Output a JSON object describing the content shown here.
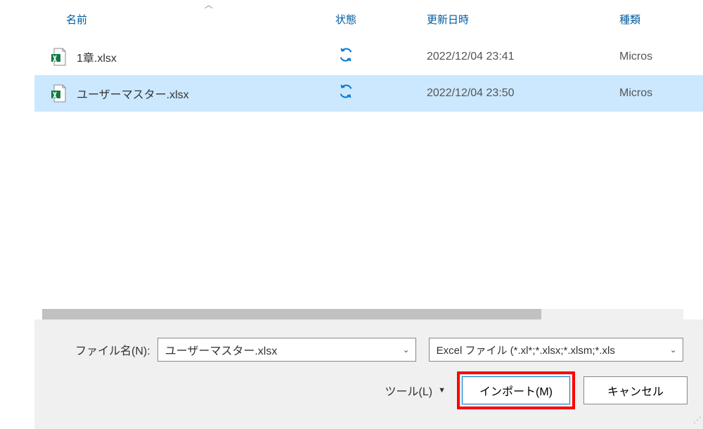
{
  "columns": {
    "name": "名前",
    "status": "状態",
    "date": "更新日時",
    "type": "種類"
  },
  "files": [
    {
      "name": "1章.xlsx",
      "date": "2022/12/04 23:41",
      "type": "Micros",
      "selected": false
    },
    {
      "name": "ユーザーマスター.xlsx",
      "date": "2022/12/04 23:50",
      "type": "Micros",
      "selected": true
    }
  ],
  "filename": {
    "label": "ファイル名(N):",
    "value": "ユーザーマスター.xlsx"
  },
  "filetype": {
    "value": "Excel ファイル (*.xl*;*.xlsx;*.xlsm;*.xls"
  },
  "tools": {
    "label": "ツール(L)"
  },
  "buttons": {
    "import": "インポート(M)",
    "cancel": "キャンセル"
  }
}
